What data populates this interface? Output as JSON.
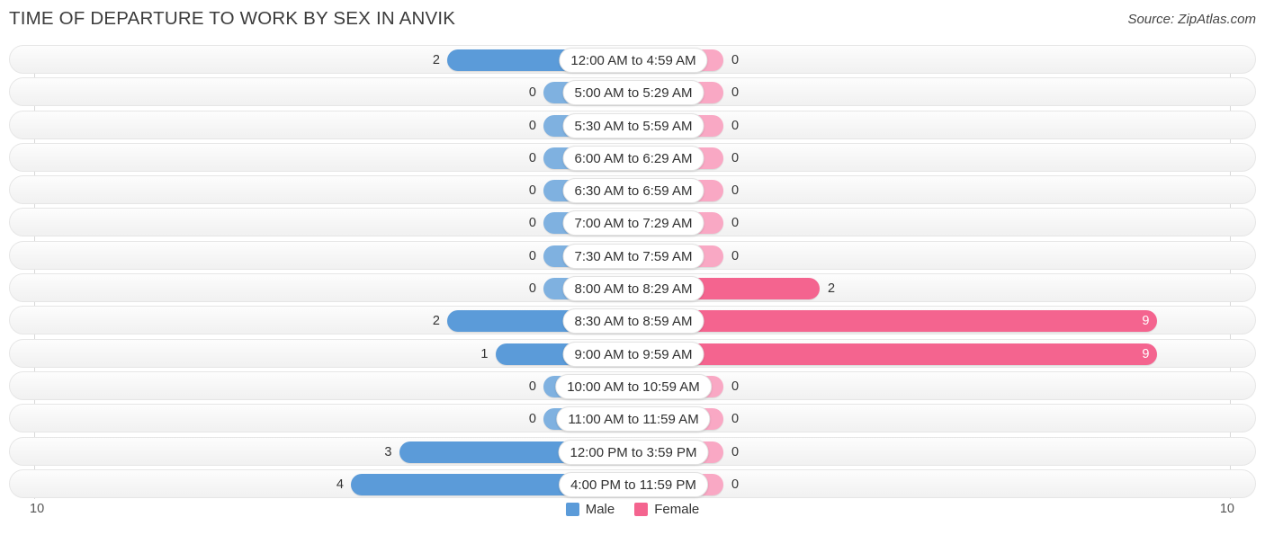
{
  "header": {
    "title": "TIME OF DEPARTURE TO WORK BY SEX IN ANVIK",
    "source": "Source: ZipAtlas.com"
  },
  "legend": {
    "male_label": "Male",
    "female_label": "Female",
    "male_color": "#5b9bd9",
    "female_color": "#f4648f"
  },
  "axis": {
    "left_tick": "10",
    "right_tick": "10"
  },
  "chart_data": {
    "type": "bar",
    "title": "TIME OF DEPARTURE TO WORK BY SEX IN ANVIK",
    "subtype": "diverging-bar",
    "xlabel": "",
    "ylabel": "",
    "xlim": [
      10,
      10
    ],
    "grid": false,
    "legend_position": "bottom-center",
    "categories": [
      "12:00 AM to 4:59 AM",
      "5:00 AM to 5:29 AM",
      "5:30 AM to 5:59 AM",
      "6:00 AM to 6:29 AM",
      "6:30 AM to 6:59 AM",
      "7:00 AM to 7:29 AM",
      "7:30 AM to 7:59 AM",
      "8:00 AM to 8:29 AM",
      "8:30 AM to 8:59 AM",
      "9:00 AM to 9:59 AM",
      "10:00 AM to 10:59 AM",
      "11:00 AM to 11:59 AM",
      "12:00 PM to 3:59 PM",
      "4:00 PM to 11:59 PM"
    ],
    "series": [
      {
        "name": "Male",
        "color": "#5b9bd9",
        "side": "left",
        "values": [
          2,
          0,
          0,
          0,
          0,
          0,
          0,
          0,
          2,
          1,
          0,
          0,
          3,
          4
        ]
      },
      {
        "name": "Female",
        "color": "#f4648f",
        "side": "right",
        "values": [
          0,
          0,
          0,
          0,
          0,
          0,
          0,
          2,
          9,
          9,
          0,
          0,
          0,
          0
        ]
      }
    ],
    "labels": {
      "male": [
        "2",
        "0",
        "0",
        "0",
        "0",
        "0",
        "0",
        "0",
        "2",
        "1",
        "0",
        "0",
        "3",
        "4"
      ],
      "female": [
        "0",
        "0",
        "0",
        "0",
        "0",
        "0",
        "0",
        "2",
        "9",
        "9",
        "0",
        "0",
        "0",
        "0"
      ]
    }
  }
}
